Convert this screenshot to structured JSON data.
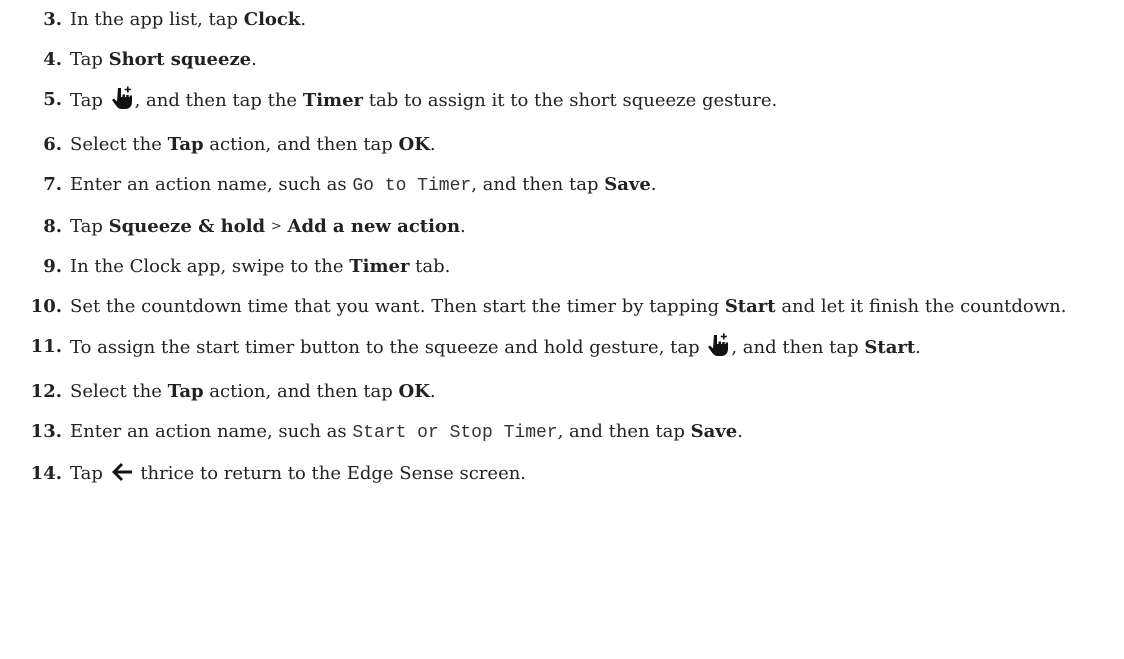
{
  "steps": [
    {
      "number": "3.",
      "t1": "In the app list, tap ",
      "b1": "Clock",
      "t2": "."
    },
    {
      "number": "4.",
      "t1": "Tap ",
      "b1": "Short squeeze",
      "t2": "."
    },
    {
      "number": "5.",
      "t1": "Tap ",
      "icon": "hand-pointer-plus-icon",
      "t2": ", and then tap the ",
      "b1": "Timer",
      "t3": " tab to assign it to the short squeeze gesture."
    },
    {
      "number": "6.",
      "t1": "Select the ",
      "b1": "Tap",
      "t2": " action, and then tap ",
      "b2": "OK",
      "t3": "."
    },
    {
      "number": "7.",
      "t1": "Enter an action name, such as ",
      "code": "Go to Timer",
      "t2": ", and then tap ",
      "b1": "Save",
      "t3": "."
    },
    {
      "number": "8.",
      "t1": "Tap ",
      "b1": "Squeeze & hold",
      "sep": ">",
      "b2": "Add a new action",
      "t2": "."
    },
    {
      "number": "9.",
      "t1": "In the Clock app, swipe to the ",
      "b1": "Timer",
      "t2": " tab."
    },
    {
      "number": "10.",
      "t1": "Set the countdown time that you want. Then start the timer by tapping ",
      "b1": "Start",
      "t2": " and let it finish the countdown."
    },
    {
      "number": "11.",
      "t1": "To assign the start timer button to the squeeze and hold gesture, tap ",
      "icon": "hand-pointer-plus-icon",
      "t2": ", and then tap ",
      "b1": "Start",
      "t3": "."
    },
    {
      "number": "12.",
      "t1": "Select the ",
      "b1": "Tap",
      "t2": " action, and then tap ",
      "b2": "OK",
      "t3": "."
    },
    {
      "number": "13.",
      "t1": "Enter an action name, such as ",
      "code": "Start or Stop Timer",
      "t2": ", and then tap ",
      "b1": "Save",
      "t3": "."
    },
    {
      "number": "14.",
      "t1": "Tap ",
      "icon": "back-arrow-icon",
      "t2": " thrice to return to the Edge Sense screen."
    }
  ]
}
